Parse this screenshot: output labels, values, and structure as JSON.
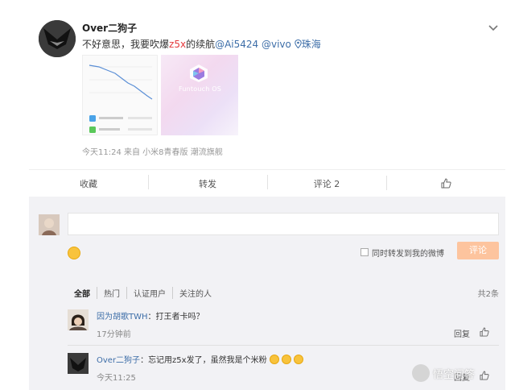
{
  "post": {
    "username": "Over二狗子",
    "text_prefix": "不好意思，我要吹爆",
    "text_highlight": "z5x",
    "text_suffix": "的续航",
    "mention1": "@Ai5424",
    "mention2": "@vivo",
    "location": "珠海",
    "meta": "今天11:24 来自 小米8青春版 潮流旗舰",
    "thumb2_label": "Funtouch OS"
  },
  "actions": {
    "favorite": "收藏",
    "repost": "转发",
    "comment": "评论 2"
  },
  "compose": {
    "repost_label": "同时转发到我的微博",
    "submit_label": "评论"
  },
  "filters": {
    "tabs": [
      "全部",
      "热门",
      "认证用户",
      "关注的人"
    ],
    "total": "共2条"
  },
  "comments": [
    {
      "user": "因为胡歌TWH",
      "sep": "：",
      "text": "打王者卡吗？",
      "time": "17分钟前",
      "reply": "回复"
    },
    {
      "user": "Over二狗子",
      "sep": "：",
      "text": "忘记用z5x发了，虽然我是个米粉",
      "time": "今天11:25",
      "reply": "回复"
    }
  ],
  "watermark": "悟空问答",
  "colors": {
    "link": "#3d6ea8",
    "highlight": "#e4393c",
    "submit_bg": "#fdc49e"
  }
}
